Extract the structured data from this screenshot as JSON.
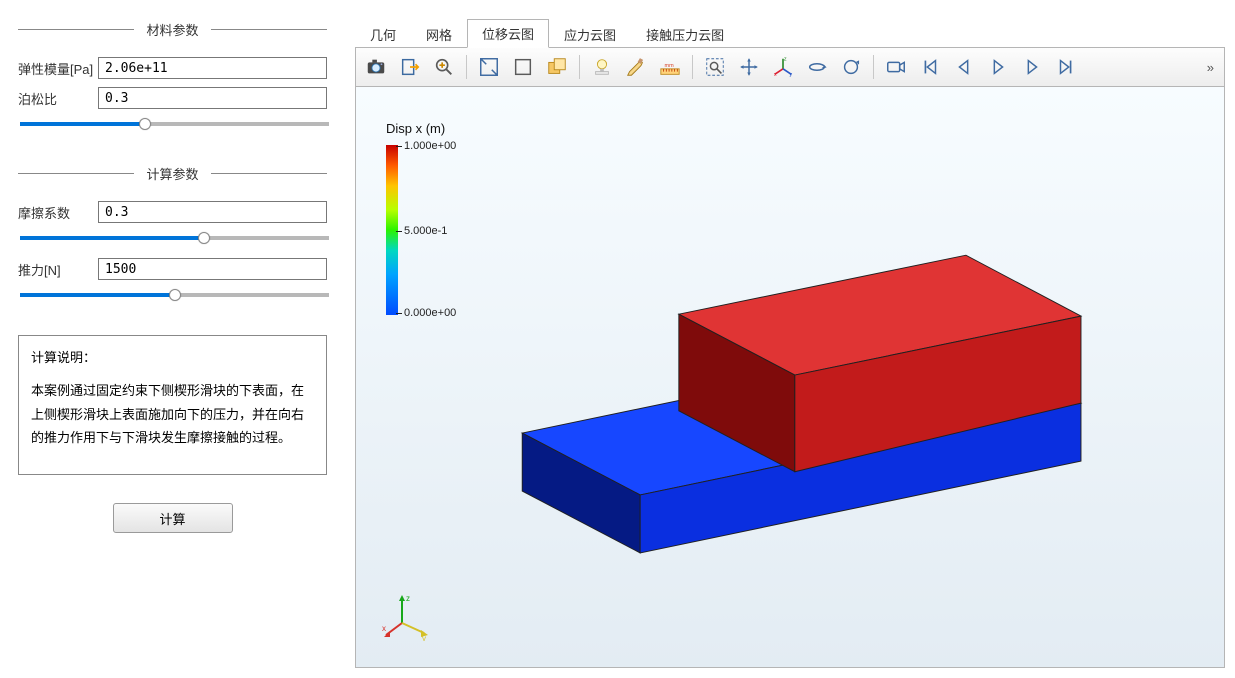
{
  "sidebar": {
    "group_material": {
      "legend": "材料参数"
    },
    "group_compute": {
      "legend": "计算参数"
    },
    "young": {
      "label": "弹性模量[Pa]",
      "value": "2.06e+11"
    },
    "poisson": {
      "label": "泊松比",
      "value": "0.3",
      "slider_percent": 40
    },
    "friction": {
      "label": "摩擦系数",
      "value": "0.3",
      "slider_percent": 60
    },
    "force": {
      "label": "推力[N]",
      "value": "1500",
      "slider_percent": 50
    },
    "description": {
      "title": "计算说明：",
      "body": "本案例通过固定约束下侧楔形滑块的下表面，在上侧楔形滑块上表面施加向下的压力，并在向右的推力作用下与下滑块发生摩擦接触的过程。"
    },
    "compute_label": "计算"
  },
  "tabs": {
    "items": [
      {
        "label": "几何"
      },
      {
        "label": "网格"
      },
      {
        "label": "位移云图"
      },
      {
        "label": "应力云图"
      },
      {
        "label": "接触压力云图"
      }
    ],
    "active_index": 2
  },
  "toolbar": {
    "overflow_glyph": "»",
    "items": [
      "camera",
      "export",
      "zoom-plus",
      "fit-box",
      "outline-box",
      "multi-box",
      "lightbulb",
      "brush",
      "ruler",
      "zoom-area",
      "pan",
      "axes",
      "rotate-y",
      "rotate-z",
      "video",
      "skip-first",
      "step-back",
      "play",
      "step-fwd",
      "skip-last"
    ]
  },
  "legend": {
    "title": "Disp x (m)",
    "ticks": [
      {
        "value": "1.000e+00",
        "pos": 0
      },
      {
        "value": "5.000e-1",
        "pos": 50
      },
      {
        "value": "0.000e+00",
        "pos": 100
      }
    ]
  },
  "colors": {
    "top_block": "#c21b1b",
    "top_block_side": "#7f0b0b",
    "top_block_top": "#e03434",
    "bottom_block": "#0a2fe0",
    "bottom_block_side": "#051a84",
    "bottom_block_top": "#1747ff",
    "edge": "#202020"
  },
  "triad": {
    "x": "x",
    "y": "y",
    "z": "z"
  }
}
